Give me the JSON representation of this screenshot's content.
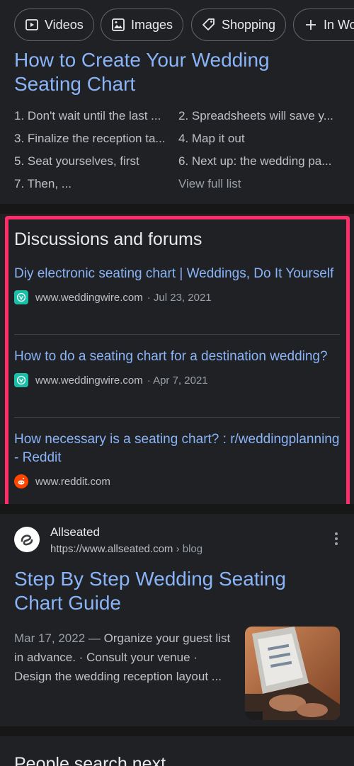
{
  "chips": [
    {
      "label": "Videos",
      "icon": "video-icon"
    },
    {
      "label": "Images",
      "icon": "image-icon"
    },
    {
      "label": "Shopping",
      "icon": "tag-icon"
    },
    {
      "label": "In Wo",
      "icon": "plus-icon"
    }
  ],
  "featured": {
    "title": "How to Create Your Wedding Seating Chart",
    "steps": [
      "1. Don't wait until the last ...",
      "2. Spreadsheets will save y...",
      "3. Finalize the reception ta...",
      "4. Map it out",
      "5. Seat yourselves, first",
      "6. Next up: the wedding pa...",
      "7. Then, ..."
    ],
    "view_all": "View full list"
  },
  "discussions": {
    "heading": "Discussions and forums",
    "threads": [
      {
        "title": "Diy electronic seating chart | Weddings, Do It Yourself",
        "site": "www.weddingwire.com",
        "date": "· Jul 23, 2021"
      },
      {
        "title": "How to do a seating chart for a destination wedding?",
        "site": "www.weddingwire.com",
        "date": "· Apr 7, 2021"
      },
      {
        "title": "How necessary is a seating chart? : r/weddingplanning - Reddit",
        "site": "www.reddit.com",
        "date": ""
      }
    ]
  },
  "result": {
    "site_name": "Allseated",
    "url": "https://www.allseated.com",
    "breadcrumb": " › blog",
    "title": "Step By Step Wedding Seating Chart Guide",
    "date": "Mar 17, 2022 —",
    "snippet": " Organize your guest list in advance. · Consult your venue · Design the wedding reception layout ..."
  },
  "bottom": {
    "heading": "People search next"
  },
  "colors": {
    "background": "#202124",
    "link": "#8ab4f8",
    "highlight_border": "#ff2e6b"
  }
}
